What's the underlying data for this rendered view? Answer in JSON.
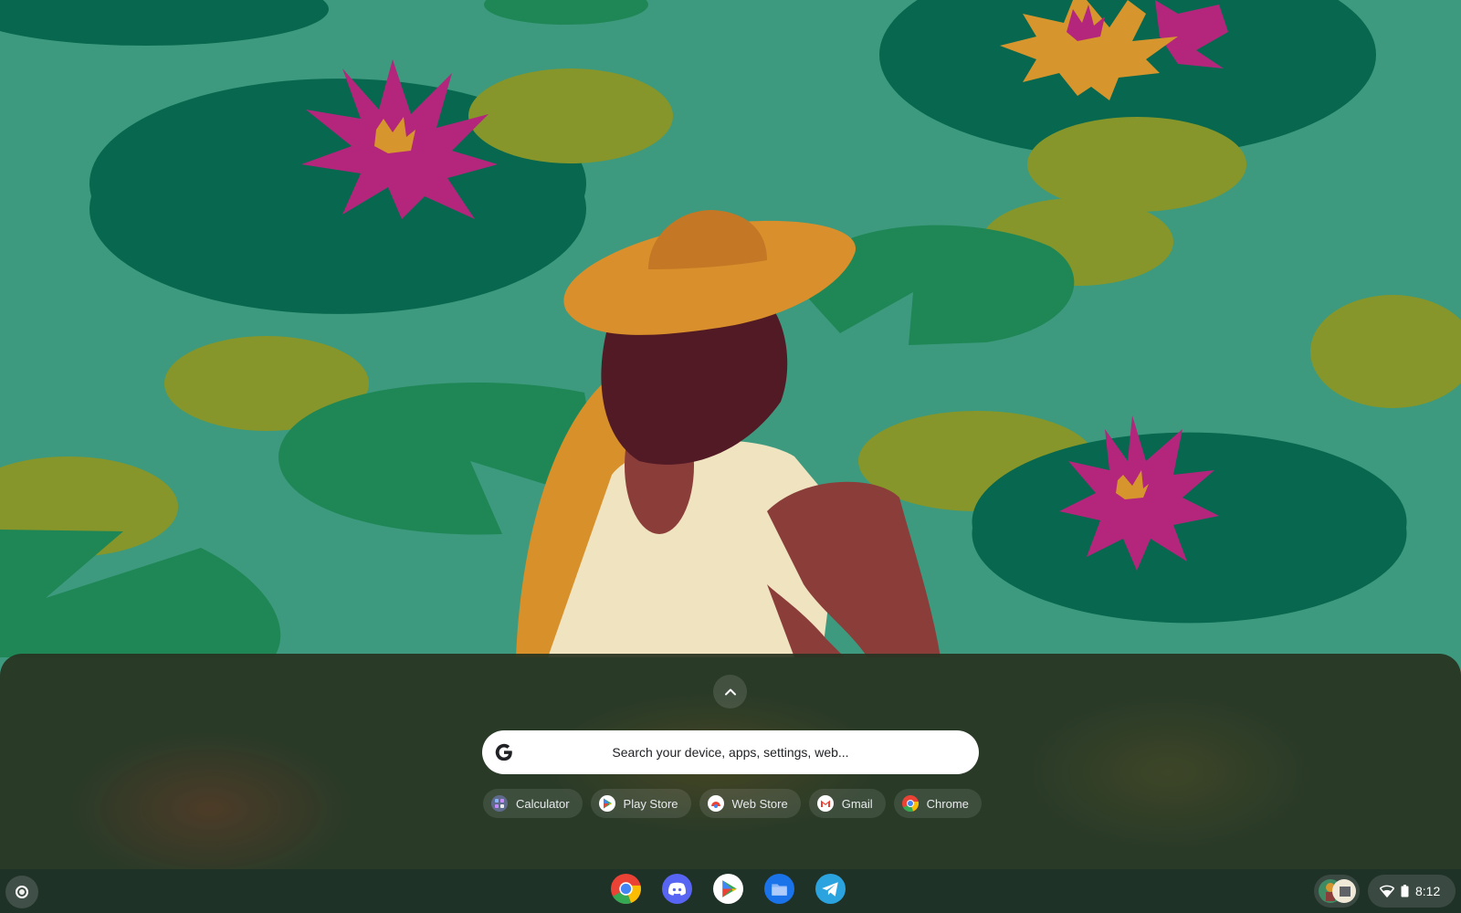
{
  "launcher": {
    "search_placeholder": "Search your device, apps, settings, web...",
    "suggestions": [
      {
        "label": "Calculator",
        "icon": "calculator-icon"
      },
      {
        "label": "Play Store",
        "icon": "play-store-icon"
      },
      {
        "label": "Web Store",
        "icon": "web-store-icon"
      },
      {
        "label": "Gmail",
        "icon": "gmail-icon"
      },
      {
        "label": "Chrome",
        "icon": "chrome-icon"
      }
    ]
  },
  "shelf": {
    "pinned_apps": [
      "chrome-icon",
      "discord-icon",
      "play-store-icon",
      "files-icon",
      "telegram-icon"
    ]
  },
  "status": {
    "time": "8:12",
    "icons": [
      "wifi-icon",
      "battery-icon"
    ]
  },
  "colors": {
    "water": "#3d9a7e",
    "lily_dark": "#07684f",
    "lily_green": "#1f8756",
    "lily_olive": "#86962a",
    "flower_magenta": "#b4267c",
    "flower_orange": "#d7952d"
  }
}
